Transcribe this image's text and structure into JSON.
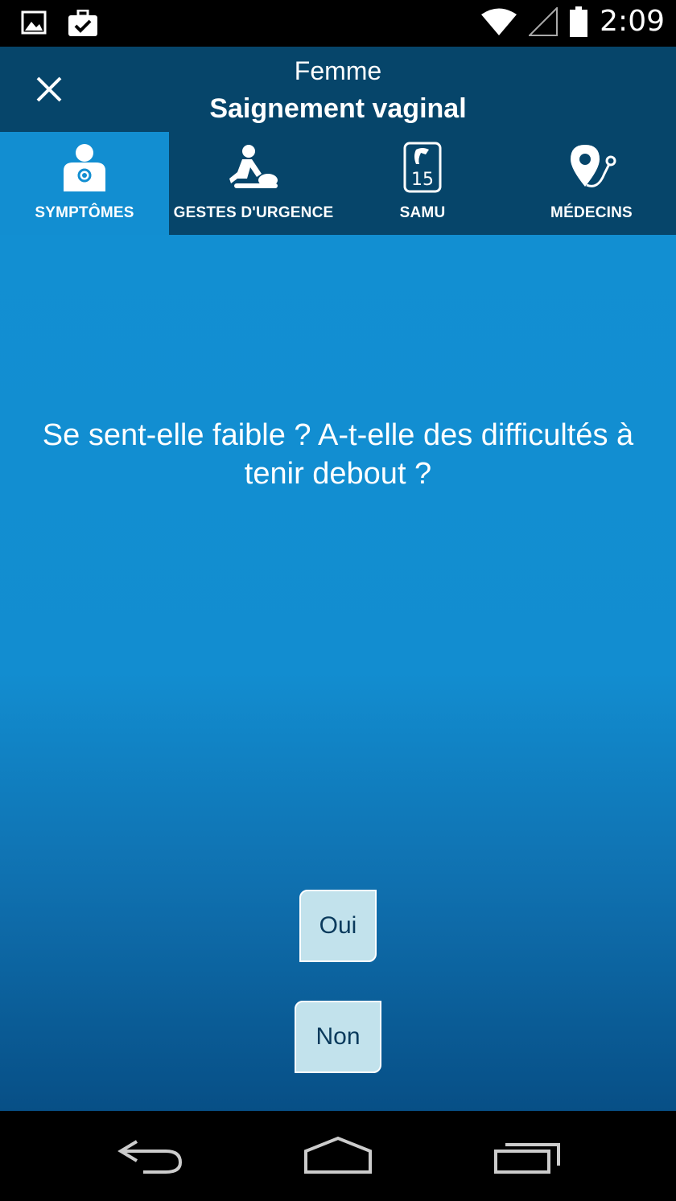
{
  "status_bar": {
    "time": "2:09",
    "icons": [
      "image-icon",
      "briefcase-check-icon",
      "wifi-icon",
      "signal-icon",
      "battery-icon"
    ]
  },
  "header": {
    "subtitle": "Femme",
    "title": "Saignement vaginal",
    "close_icon": "close-icon"
  },
  "tabs": [
    {
      "label": "SYMPTÔMES",
      "icon": "patient-icon",
      "active": true
    },
    {
      "label": "GESTES D'URGENCE",
      "icon": "cpr-icon",
      "active": false
    },
    {
      "label": "SAMU",
      "icon": "phone-15-icon",
      "active": false
    },
    {
      "label": "MÉDECINS",
      "icon": "stethoscope-icon",
      "active": false
    }
  ],
  "question": {
    "text": "Se sent-elle faible ? A-t-elle des difficultés à tenir debout ?"
  },
  "answers": {
    "yes_label": "Oui",
    "no_label": "Non"
  },
  "nav_bar": {
    "icons": [
      "back-icon",
      "home-icon",
      "recents-icon"
    ]
  },
  "colors": {
    "header_bg": "#06456a",
    "active_tab_bg": "#128ed1",
    "main_top": "#128fd2",
    "main_bottom": "#074f86",
    "button_bg": "#c2e2ec",
    "button_text": "#0a3a5c"
  }
}
